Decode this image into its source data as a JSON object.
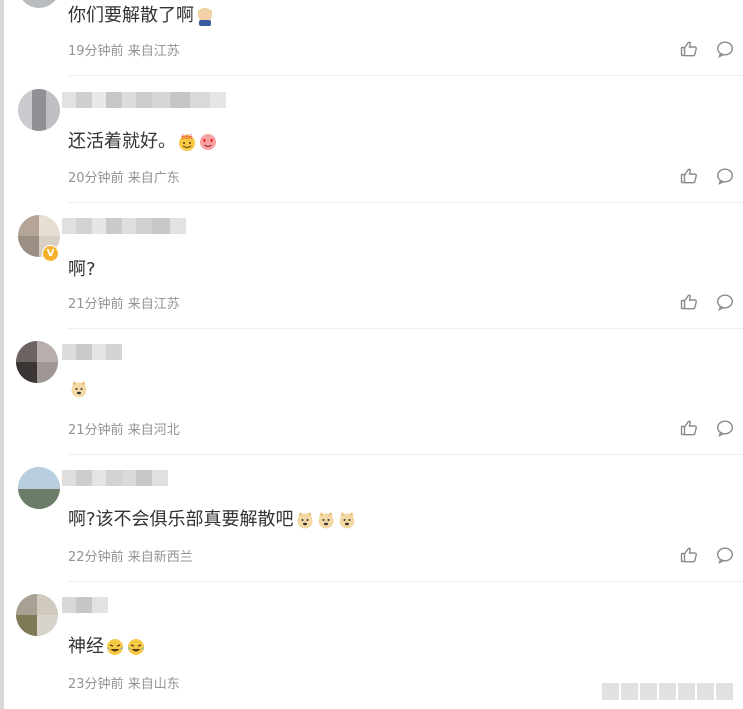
{
  "comments": [
    {
      "text": "你们要解散了啊",
      "emoji": [
        "boy-emoji"
      ],
      "time": "19分钟前",
      "location": "来自江苏"
    },
    {
      "text": "还活着就好。",
      "emoji": [
        "666-emoji",
        "heart-eyes-emoji"
      ],
      "time": "20分钟前",
      "location": "来自广东"
    },
    {
      "text": "啊?",
      "emoji": [],
      "time": "21分钟前",
      "location": "来自江苏"
    },
    {
      "text": "",
      "emoji": [
        "doge-emoji"
      ],
      "time": "21分钟前",
      "location": "来自河北"
    },
    {
      "text": "啊?该不会俱乐部真要解散吧",
      "emoji": [
        "doge-emoji",
        "doge-emoji",
        "doge-emoji"
      ],
      "time": "22分钟前",
      "location": "来自新西兰"
    },
    {
      "text": "神经",
      "emoji": [
        "laugh-cry-emoji",
        "laugh-cry-emoji"
      ],
      "time": "23分钟前",
      "location": "来自山东"
    }
  ],
  "icons": {
    "like": "thumbs-up-icon",
    "reply": "comment-bubble-icon"
  },
  "colors": {
    "meta": "#939393",
    "text": "#333333",
    "verified": "#f5b12b",
    "divider": "#eeeeee"
  }
}
